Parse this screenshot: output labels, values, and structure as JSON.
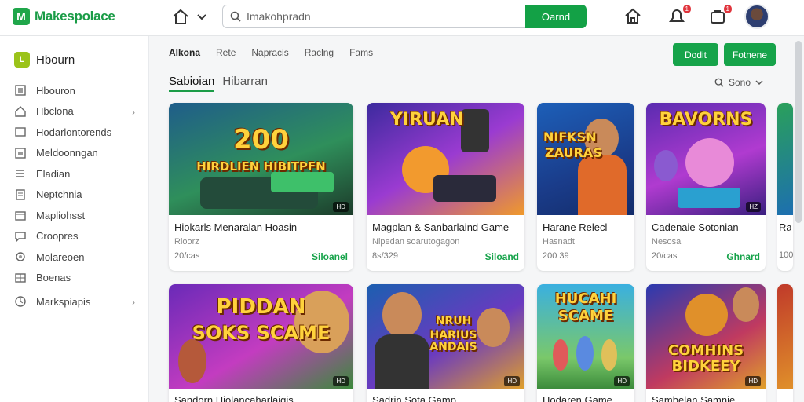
{
  "header": {
    "logo_text": "Makespolace",
    "search_placeholder": "Imakohpradn",
    "search_button": "Oarnd",
    "notif_badge": "1",
    "cart_badge": "1"
  },
  "sidebar": {
    "heading": "Hbourn",
    "items": [
      {
        "label": "Hbouron",
        "chevron": false
      },
      {
        "label": "Hbclona",
        "chevron": true
      },
      {
        "label": "Hodarlontorends",
        "chevron": false
      },
      {
        "label": "Meldoonngan",
        "chevron": false
      },
      {
        "label": "Eladian",
        "chevron": false
      },
      {
        "label": "Neptchnia",
        "chevron": false
      },
      {
        "label": "Mapliohsst",
        "chevron": false
      },
      {
        "label": "Croopres",
        "chevron": false
      },
      {
        "label": "Molareoen",
        "chevron": false
      },
      {
        "label": "Boenas",
        "chevron": false
      },
      {
        "label": "Markspiapis",
        "chevron": true
      }
    ]
  },
  "tabs": [
    "Alkona",
    "Rete",
    "Napracis",
    "Raclng",
    "Fams"
  ],
  "actions": {
    "primary": "Dodit",
    "secondary": "Fotnene"
  },
  "section": {
    "active": "Sabioian",
    "other": "Hibarran",
    "sort_label": "Sono"
  },
  "cards_row1": [
    {
      "thumb_title": "200",
      "thumb_sub": "HIRDLIEN HIBITPFN",
      "tag": "HD",
      "title": "Hiokarls Menaralan Hoasin",
      "sub": "Rioorz",
      "meta": "20/cas",
      "price": "Siloanel"
    },
    {
      "thumb_title": "YIRUAN",
      "thumb_sub": "",
      "tag": "",
      "title": "Magplan & Sanbarlaind Game",
      "sub": "Nipedan soarutogagon",
      "meta": "8s/329",
      "price": "Siloand"
    },
    {
      "thumb_title": "NIFKSN",
      "thumb_sub": "ZAURAS",
      "tag": "",
      "title": "Harane Relecl",
      "sub": "Hasnadt",
      "meta": "200 39",
      "price": ""
    },
    {
      "thumb_title": "BAVORNS",
      "thumb_sub": "",
      "tag": "HZ",
      "title": "Cadenaie Sotonian",
      "sub": "Nesosa",
      "meta": "20/cas",
      "price": "Ghnard"
    },
    {
      "thumb_title": "",
      "thumb_sub": "",
      "tag": "",
      "title": "Ra",
      "sub": "",
      "meta": "100",
      "price": ""
    }
  ],
  "cards_row2": [
    {
      "thumb_title": "PIDDAN",
      "thumb_sub": "SOKS SCAME",
      "tag": "HD",
      "title": "Sandorn Hiolancaharlaigis"
    },
    {
      "thumb_title": "NRUH",
      "thumb_sub": "HARIUS ANDAIS",
      "tag": "HD",
      "title": "Sadrin Sota Gamp"
    },
    {
      "thumb_title": "HUCAHI",
      "thumb_sub": "SCAME",
      "tag": "HD",
      "title": "Hodaren Game"
    },
    {
      "thumb_title": "COMHINS",
      "thumb_sub": "BIDKEEY",
      "tag": "HD",
      "title": "Sambelan Samnie"
    }
  ]
}
